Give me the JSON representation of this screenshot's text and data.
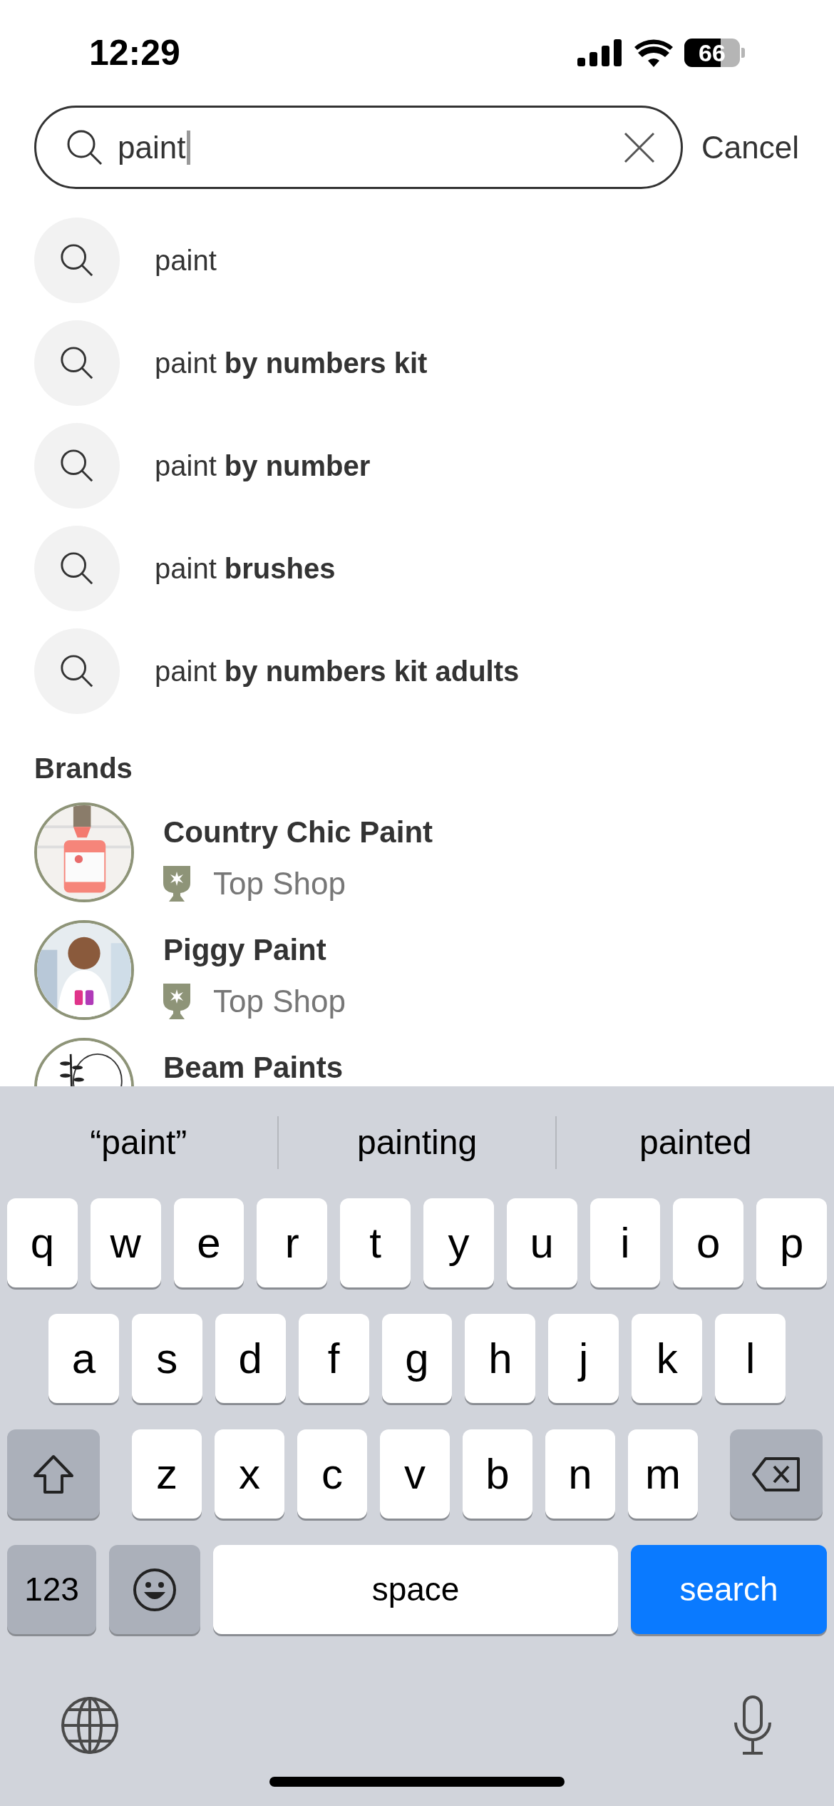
{
  "status_bar": {
    "time": "12:29",
    "battery": "66"
  },
  "search": {
    "value": "paint",
    "cancel": "Cancel"
  },
  "suggestions": [
    {
      "text": "paint"
    },
    {
      "text": "paint **by numbers kit**"
    },
    {
      "text": "paint **by number**"
    },
    {
      "text": "paint **brushes**"
    },
    {
      "text": "paint **by numbers kit adults**"
    }
  ],
  "brands": {
    "title": "Brands",
    "items": [
      {
        "name": "Country Chic Paint",
        "badge": "Top Shop",
        "kind": "picture"
      },
      {
        "name": "Piggy Paint",
        "badge": "Top Shop",
        "kind": "picture"
      },
      {
        "name": "Beam Paints",
        "kind": "picture"
      }
    ]
  },
  "keyboard": {
    "suggestions": [
      "“paint”",
      "painting",
      "painted"
    ],
    "rows": [
      [
        "q",
        "w",
        "e",
        "r",
        "t",
        "y",
        "u",
        "i",
        "o",
        "p"
      ],
      [
        "a",
        "s",
        "d",
        "f",
        "g",
        "h",
        "j",
        "k",
        "l"
      ],
      [
        {
          "kind": "shift"
        },
        "z",
        "x",
        "c",
        "v",
        "b",
        "n",
        "m",
        {
          "kind": "delete"
        }
      ]
    ],
    "bottom_keys": [
      {
        "kind": "numbers",
        "label": "123"
      },
      {
        "kind": "emoji"
      },
      {
        "kind": "space",
        "label": "space"
      },
      {
        "kind": "search",
        "label": "search"
      }
    ]
  }
}
